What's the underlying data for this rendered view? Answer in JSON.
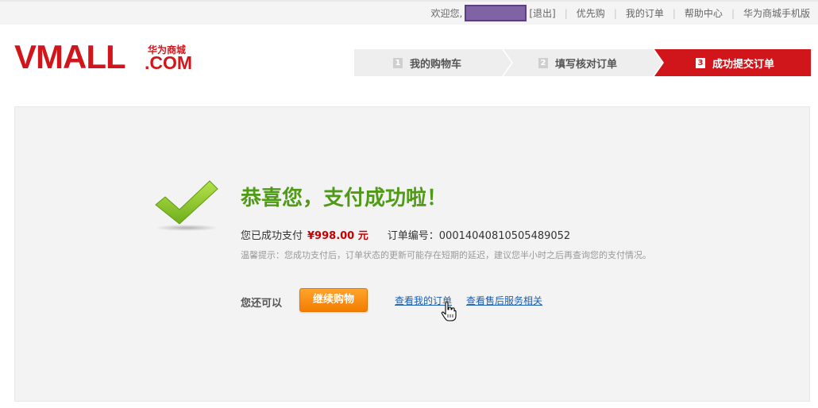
{
  "topbar": {
    "welcome": "欢迎您,",
    "logout": "[退出]",
    "links": [
      "优先购",
      "我的订单",
      "帮助中心",
      "华为商城手机版"
    ]
  },
  "logo": {
    "brand": "VMALL",
    "com": ".COM",
    "cn": "华为商城",
    "color": "#d1161b"
  },
  "steps": [
    {
      "num": "1",
      "label": "我的购物车",
      "active": false
    },
    {
      "num": "2",
      "label": "填写核对订单",
      "active": false
    },
    {
      "num": "3",
      "label": "成功提交订单",
      "active": true
    }
  ],
  "result": {
    "title": "恭喜您，支付成功啦！",
    "paid_label": "您已成功支付",
    "amount": "¥998.00 元",
    "order_label": "订单编号：",
    "order_number": "00014040810505489052",
    "tip": "温馨提示：您成功支付后，订单状态的更新可能存在短期的延迟，建议您半小时之后再查询您的支付情况。",
    "also_label": "您还可以",
    "continue_button": "继续购物",
    "link_orders": "查看我的订单",
    "link_service": "查看售后服务相关"
  },
  "colors": {
    "accent": "#d1161b",
    "success": "#4f9a16",
    "button": "#f47c00",
    "link": "#1a5fb4"
  }
}
